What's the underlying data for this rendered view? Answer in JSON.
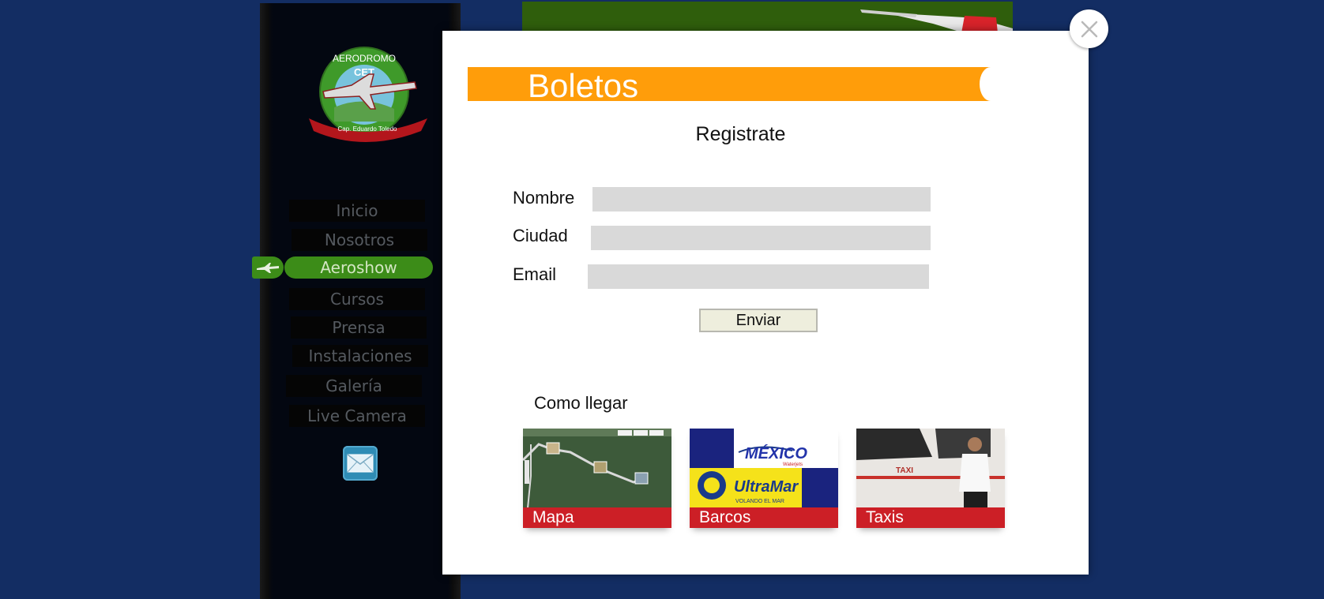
{
  "logo": {
    "top_text": "AERODROMO",
    "badge_text": "CET",
    "ribbon_text": "Cap. Eduardo Toledo"
  },
  "nav": {
    "items": [
      {
        "label": "Inicio",
        "active": false
      },
      {
        "label": "Nosotros",
        "active": false
      },
      {
        "label": "Aeroshow",
        "active": true
      },
      {
        "label": "Cursos",
        "active": false
      },
      {
        "label": "Prensa",
        "active": false
      },
      {
        "label": "Instalaciones",
        "active": false
      },
      {
        "label": "Galería",
        "active": false
      },
      {
        "label": "Live Camera",
        "active": false
      }
    ]
  },
  "modal": {
    "banner_title": "Boletos",
    "form_title": "Registrate",
    "fields": [
      {
        "label": "Nombre",
        "value": ""
      },
      {
        "label": "Ciudad",
        "value": ""
      },
      {
        "label": "Email",
        "value": ""
      }
    ],
    "submit_label": "Enviar",
    "directions_title": "Como llegar",
    "cards": [
      {
        "label": "Mapa"
      },
      {
        "label": "Barcos",
        "logo_top": "MÉXICO",
        "logo_top_sub": "Waterjets",
        "logo_bottom": "UltraMar",
        "logo_bottom_sub": "VOLANDO EL MAR"
      },
      {
        "label": "Taxis",
        "van_text": "TAXI"
      }
    ]
  },
  "colors": {
    "page_background": "#132d63",
    "banner": "#ff9d0a",
    "nav_active": "#3c8c18",
    "card_label": "#cc1f26"
  }
}
